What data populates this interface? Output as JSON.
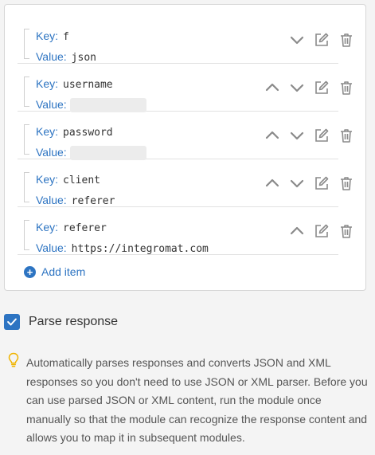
{
  "key_label": "Key:",
  "value_label": "Value:",
  "items": [
    {
      "key": "f",
      "value": "json",
      "value_redacted": false,
      "has_up": false,
      "has_down": true
    },
    {
      "key": "username",
      "value": "",
      "value_redacted": true,
      "has_up": true,
      "has_down": true
    },
    {
      "key": "password",
      "value": "",
      "value_redacted": true,
      "has_up": true,
      "has_down": true
    },
    {
      "key": "client",
      "value": "referer",
      "value_redacted": false,
      "has_up": true,
      "has_down": true
    },
    {
      "key": "referer",
      "value": "https://integromat.com",
      "value_redacted": false,
      "has_up": true,
      "has_down": false
    }
  ],
  "add_item_label": "Add item",
  "parse_response": {
    "label": "Parse response",
    "checked": true
  },
  "hint": "Automatically parses responses and converts JSON and XML responses so you don't need to use JSON or XML parser. Before you can use parsed JSON or XML content, run the module once manually so that the module can recognize the response content and allows you to map it in subsequent modules.",
  "colors": {
    "accent": "#2d74c2",
    "icon": "#8a8a8a",
    "bulb": "#f0b400"
  },
  "icons": {
    "up": "chevron-up-icon",
    "down": "chevron-down-icon",
    "edit": "edit-icon",
    "delete": "trash-icon",
    "add": "plus-circle-icon",
    "hint": "lightbulb-icon"
  }
}
